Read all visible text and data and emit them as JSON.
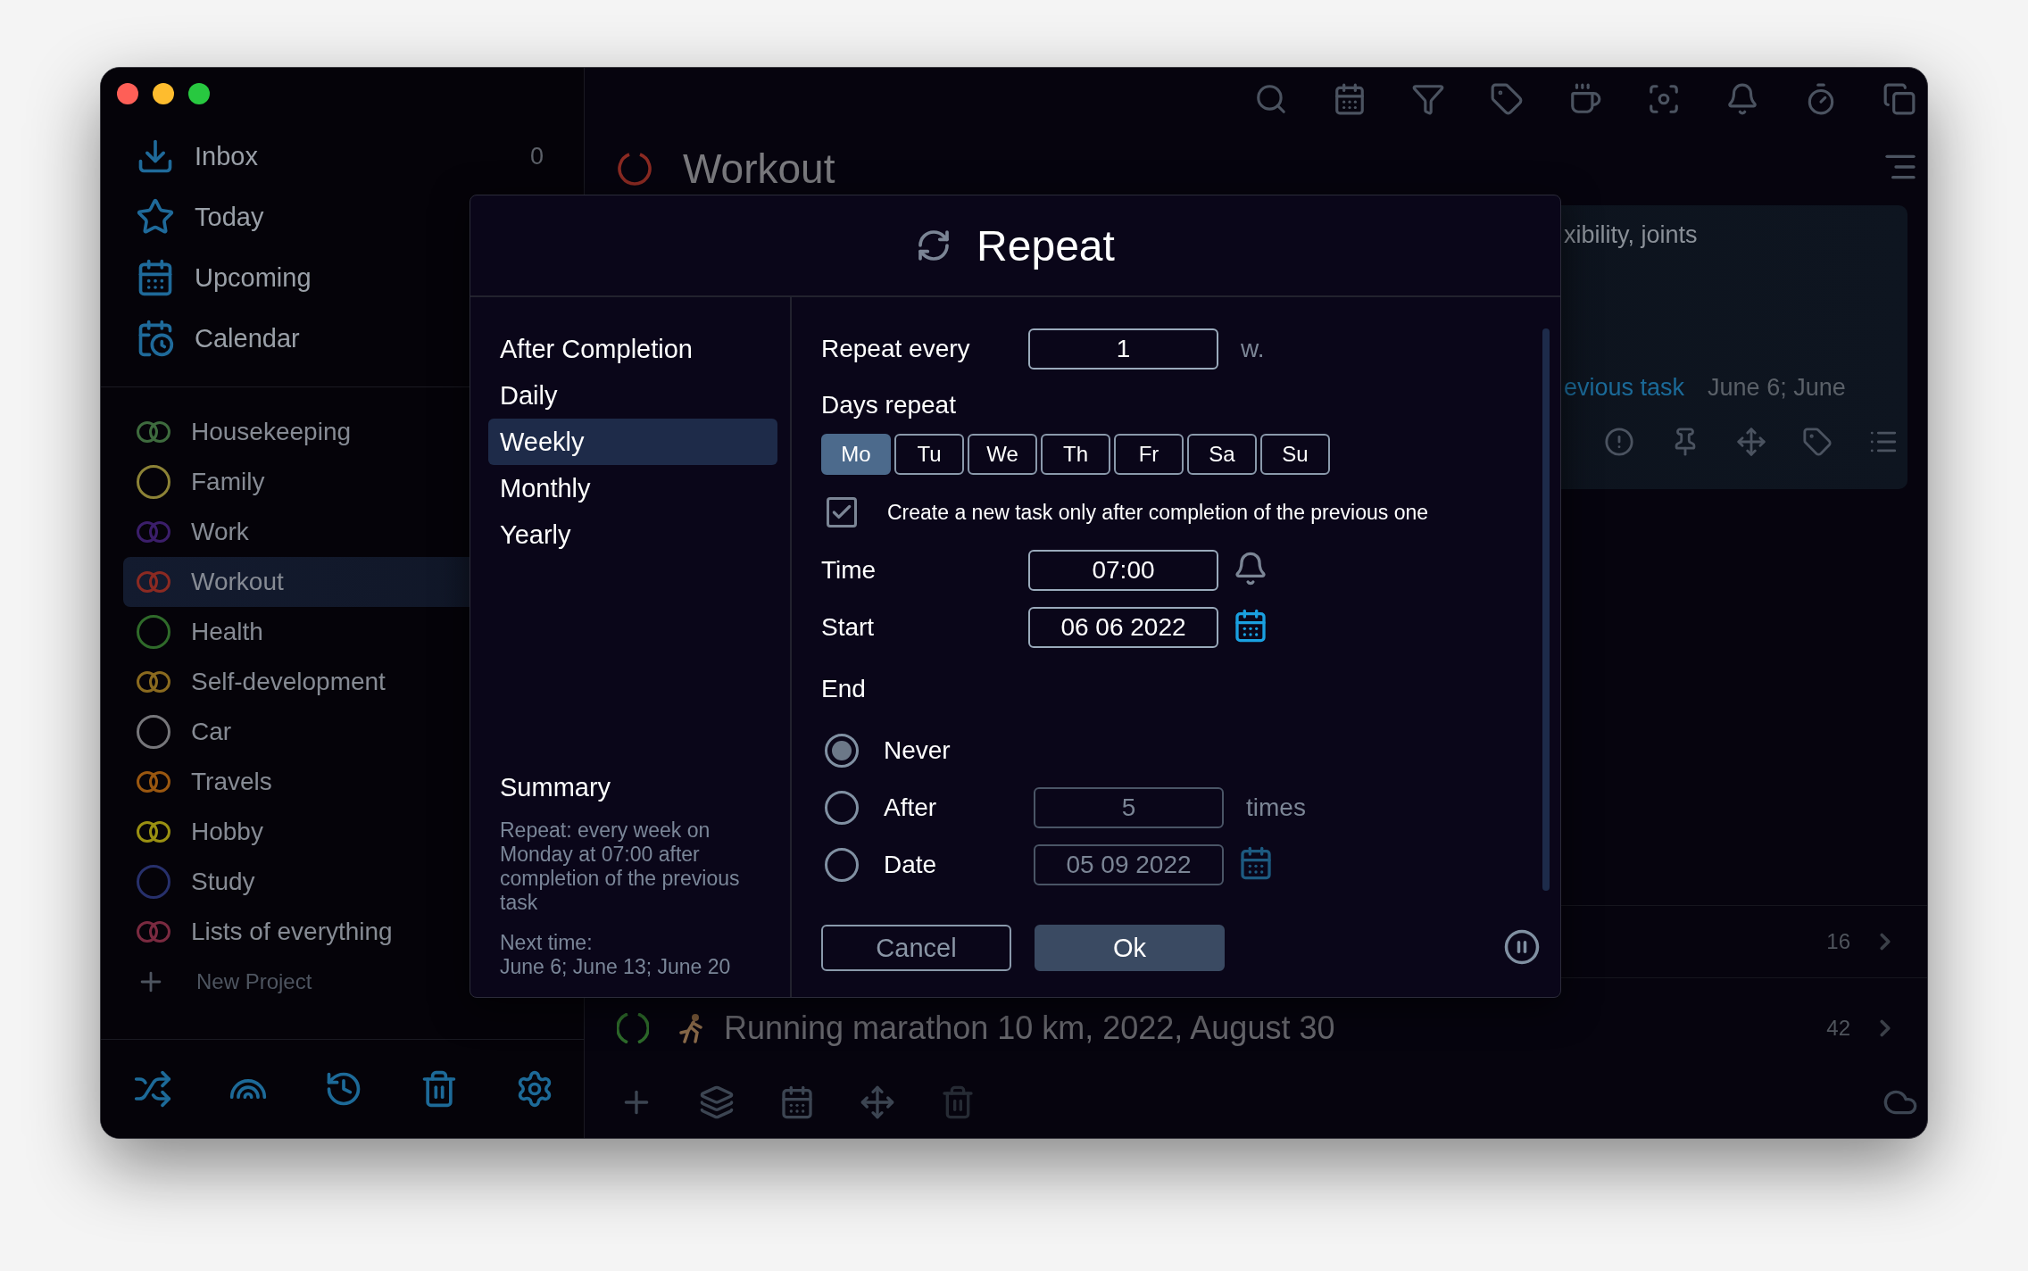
{
  "sidebar": {
    "nav": [
      {
        "kind": "inbox",
        "label": "Inbox",
        "count": "0",
        "selected": false
      },
      {
        "kind": "today",
        "label": "Today",
        "selected": false
      },
      {
        "kind": "upcoming",
        "label": "Upcoming",
        "selected": false
      },
      {
        "kind": "calendar",
        "label": "Calendar",
        "selected": false
      }
    ],
    "projects": [
      {
        "label": "Housekeeping",
        "color": "#3e6b3e",
        "kind": "double",
        "selected": false
      },
      {
        "label": "Family",
        "color": "#8c8236",
        "kind": "ring",
        "selected": false
      },
      {
        "label": "Work",
        "color": "#3b1e6a",
        "kind": "double",
        "selected": false
      },
      {
        "label": "Workout",
        "color": "#8b2a22",
        "kind": "double",
        "selected": true
      },
      {
        "label": "Health",
        "color": "#2f6a2a",
        "kind": "ring",
        "selected": false
      },
      {
        "label": "Self-development",
        "color": "#8a6a1f",
        "kind": "double",
        "selected": false
      },
      {
        "label": "Car",
        "color": "#76767a",
        "kind": "ring",
        "selected": false
      },
      {
        "label": "Travels",
        "color": "#9a5710",
        "kind": "double",
        "selected": false
      },
      {
        "label": "Hobby",
        "color": "#9a9012",
        "kind": "double",
        "selected": false
      },
      {
        "label": "Study",
        "color": "#27306b",
        "kind": "ring",
        "selected": false
      },
      {
        "label": "Lists of everything",
        "color": "#7a2a40",
        "kind": "double",
        "selected": false
      }
    ],
    "new_project": "New Project"
  },
  "main": {
    "title": "Workout",
    "card": {
      "text": "xibility, joints",
      "link": "evious task",
      "dates": "June 6; June"
    },
    "rows": [
      {
        "count": "16"
      },
      {
        "title": "Running marathon 10 km, 2022, August 30",
        "count": "42"
      }
    ]
  },
  "dialog": {
    "title": "Repeat",
    "modes": [
      {
        "label": "After Completion",
        "selected": false
      },
      {
        "label": "Daily",
        "selected": false
      },
      {
        "label": "Weekly",
        "selected": true
      },
      {
        "label": "Monthly",
        "selected": false
      },
      {
        "label": "Yearly",
        "selected": false
      }
    ],
    "summary_heading": "Summary",
    "summary": "Repeat: every week on Monday at 07:00 after completion of the previous task",
    "next_time_label": "Next time:",
    "next_time": "June 6; June 13; June 20",
    "repeat_every": {
      "label": "Repeat every",
      "value": "1",
      "unit": "w."
    },
    "days_label": "Days repeat",
    "days": [
      {
        "label": "Mo",
        "selected": true
      },
      {
        "label": "Tu",
        "selected": false
      },
      {
        "label": "We",
        "selected": false
      },
      {
        "label": "Th",
        "selected": false
      },
      {
        "label": "Fr",
        "selected": false
      },
      {
        "label": "Sa",
        "selected": false
      },
      {
        "label": "Su",
        "selected": false
      }
    ],
    "only_after_completion": {
      "label": "Create a new task only after completion of the previous one",
      "checked": true
    },
    "time": {
      "label": "Time",
      "value": "07:00"
    },
    "start": {
      "label": "Start",
      "value": "06 06 2022"
    },
    "end_label": "End",
    "end_options": [
      {
        "kind": "never",
        "label": "Never",
        "selected": true
      },
      {
        "kind": "count",
        "label": "After",
        "value": "5",
        "suffix": "times",
        "selected": false
      },
      {
        "kind": "date",
        "label": "Date",
        "value": "05 09 2022",
        "selected": false
      }
    ],
    "cancel": "Cancel",
    "ok": "Ok"
  }
}
